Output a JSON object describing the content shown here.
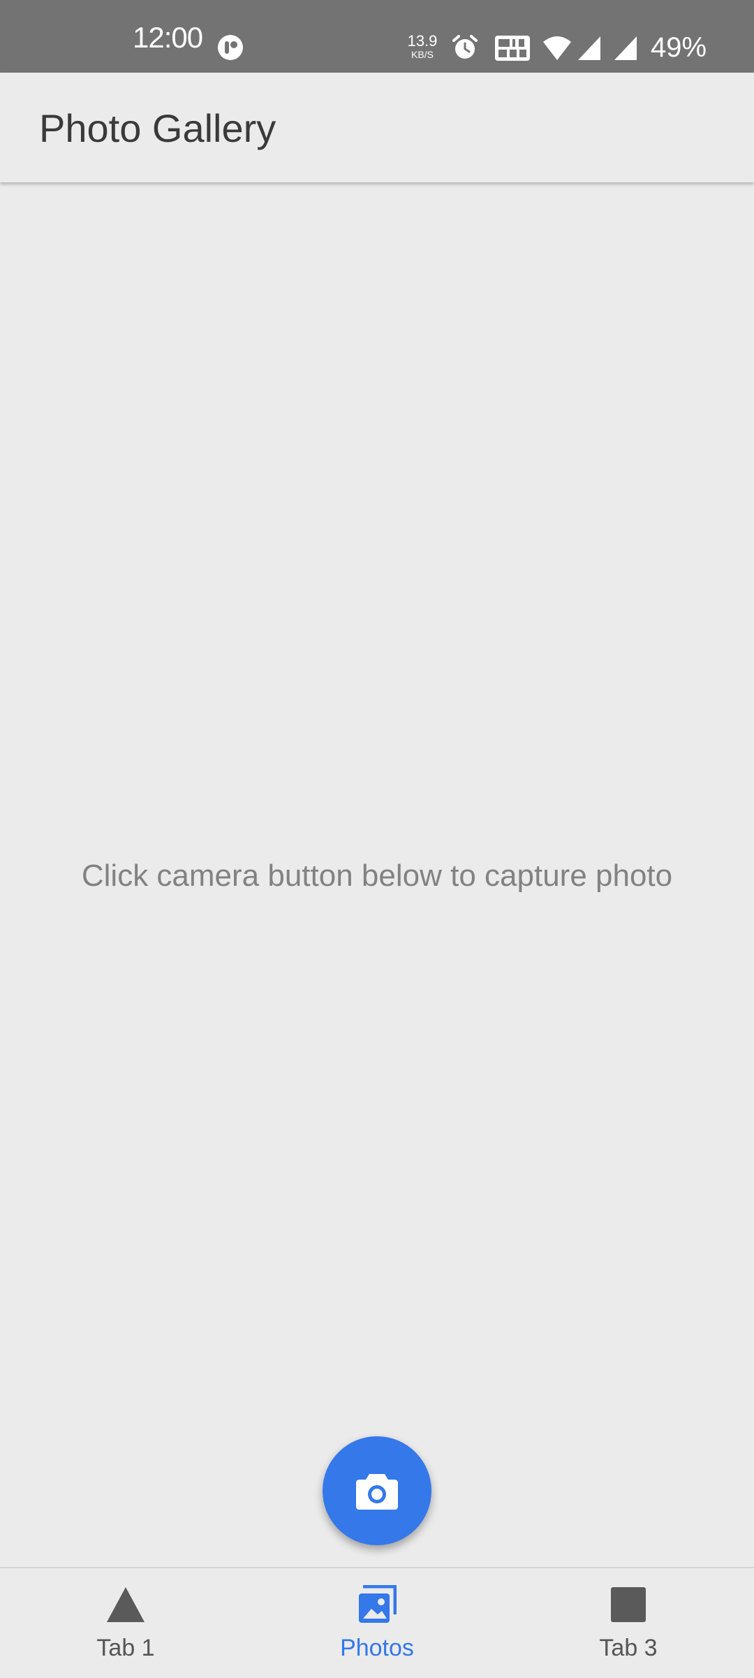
{
  "status_bar": {
    "time": "12:00",
    "net_speed_value": "13.9",
    "net_speed_unit": "KB/S",
    "battery": "49%",
    "icons": [
      "notification-icon",
      "alarm-icon",
      "volte-icon",
      "wifi-icon",
      "signal-icon",
      "signal-icon"
    ]
  },
  "app_bar": {
    "title": "Photo Gallery"
  },
  "content": {
    "empty_message": "Click camera button below to capture photo"
  },
  "fab": {
    "icon": "camera-icon",
    "color": "#3478ea"
  },
  "tabs": [
    {
      "label": "Tab 1",
      "icon": "triangle-icon",
      "selected": false
    },
    {
      "label": "Photos",
      "icon": "images-icon",
      "selected": true
    },
    {
      "label": "Tab 3",
      "icon": "square-icon",
      "selected": false
    }
  ],
  "colors": {
    "accent": "#3478ea",
    "tab_inactive": "#555555",
    "background": "#ebebeb",
    "status_bar": "#737373"
  }
}
